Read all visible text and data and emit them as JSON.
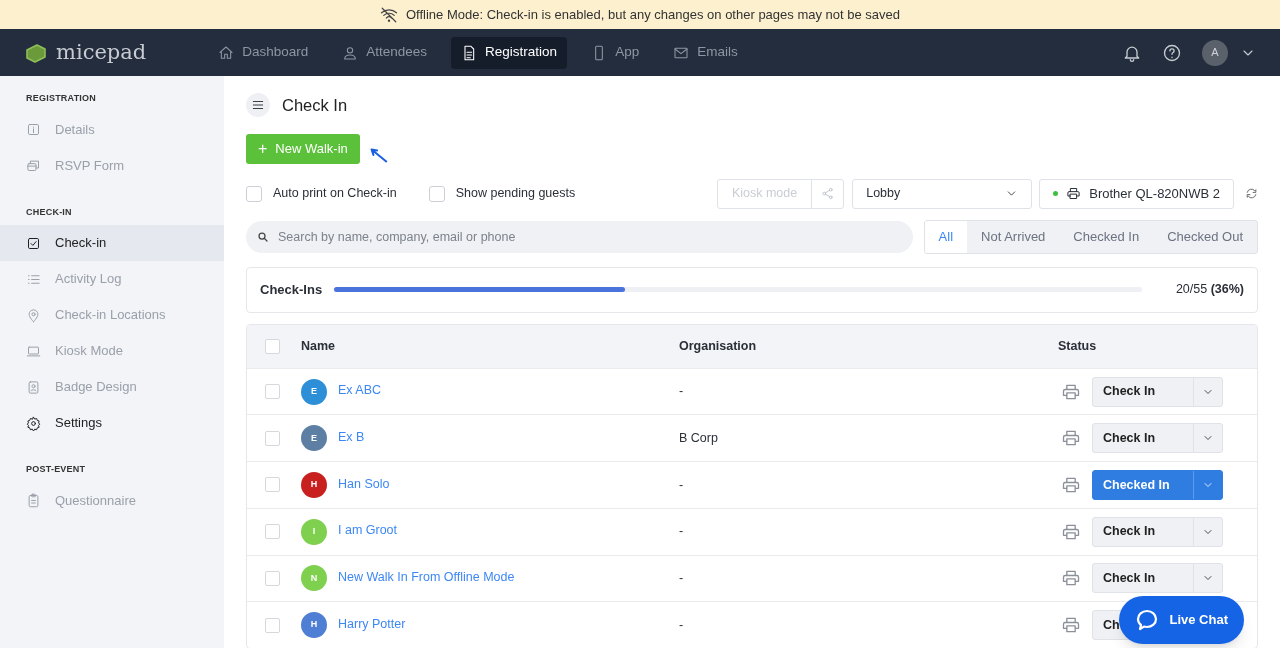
{
  "banner": {
    "text": "Offline Mode: Check-in is enabled, but any changes on other pages may not be saved"
  },
  "navbar": {
    "logo": "micepad",
    "items": [
      {
        "label": "Dashboard",
        "selected": false
      },
      {
        "label": "Attendees",
        "selected": false
      },
      {
        "label": "Registration",
        "selected": true
      },
      {
        "label": "App",
        "selected": false
      },
      {
        "label": "Emails",
        "selected": false
      }
    ],
    "avatar": "A"
  },
  "sidebar": {
    "sections": [
      {
        "title": "REGISTRATION",
        "items": [
          {
            "label": "Details",
            "selected": false,
            "disabled": true
          },
          {
            "label": "RSVP Form",
            "selected": false,
            "disabled": true
          }
        ]
      },
      {
        "title": "CHECK-IN",
        "items": [
          {
            "label": "Check-in",
            "selected": true,
            "disabled": false
          },
          {
            "label": "Activity Log",
            "selected": false,
            "disabled": true
          },
          {
            "label": "Check-in Locations",
            "selected": false,
            "disabled": true
          },
          {
            "label": "Kiosk Mode",
            "selected": false,
            "disabled": true
          },
          {
            "label": "Badge Design",
            "selected": false,
            "disabled": true
          },
          {
            "label": "Settings",
            "selected": false,
            "disabled": false
          }
        ]
      },
      {
        "title": "POST-EVENT",
        "items": [
          {
            "label": "Questionnaire",
            "selected": false,
            "disabled": true
          }
        ]
      }
    ]
  },
  "page": {
    "title": "Check In",
    "new_button": "New Walk-in",
    "new_button_icon": "+",
    "options": [
      {
        "label": "Auto print on Check-in",
        "checked": false
      },
      {
        "label": "Show pending guests",
        "checked": false
      }
    ],
    "kiosk_button": {
      "label": "Kiosk mode",
      "disabled": true
    },
    "location": "Lobby",
    "printer": {
      "label": "Brother QL-820NWB 2",
      "color": "#3fbf3f"
    },
    "search": {
      "placeholder": "Search by name, company, email or phone"
    },
    "filters": [
      {
        "label": "All",
        "selected": true
      },
      {
        "label": "Not Arrived",
        "selected": false
      },
      {
        "label": "Checked In",
        "selected": false
      },
      {
        "label": "Checked Out",
        "selected": false
      }
    ],
    "progress": {
      "label": "Check-Ins",
      "level": 0.36,
      "count": "20/55",
      "percent": "(36%)"
    }
  },
  "table": {
    "columns": [
      "Name",
      "Organisation",
      "Status"
    ],
    "all_selected": false,
    "rows": [
      {
        "initial": "E",
        "color": "#2d8fd8",
        "name": "Ex ABC",
        "organisation": "-",
        "status": "Check In",
        "checked_in": false,
        "selected": false
      },
      {
        "initial": "E",
        "color": "#5e7fa4",
        "name": "Ex B",
        "organisation": "B Corp",
        "status": "Check In",
        "checked_in": false,
        "selected": false
      },
      {
        "initial": "H",
        "color": "#c8201f",
        "name": "Han Solo",
        "organisation": "-",
        "status": "Checked In",
        "checked_in": true,
        "selected": false
      },
      {
        "initial": "I",
        "color": "#7ed04e",
        "name": "I am Groot",
        "organisation": "-",
        "status": "Check In",
        "checked_in": false,
        "selected": false
      },
      {
        "initial": "N",
        "color": "#7ed04e",
        "name": "New Walk In From Offline Mode",
        "organisation": "-",
        "status": "Check In",
        "checked_in": false,
        "selected": false
      },
      {
        "initial": "H",
        "color": "#4f7fd4",
        "name": "Harry Potter",
        "organisation": "-",
        "status": "Ch",
        "checked_in": false,
        "selected": false
      }
    ]
  },
  "live_chat": {
    "label": "Live Chat"
  }
}
